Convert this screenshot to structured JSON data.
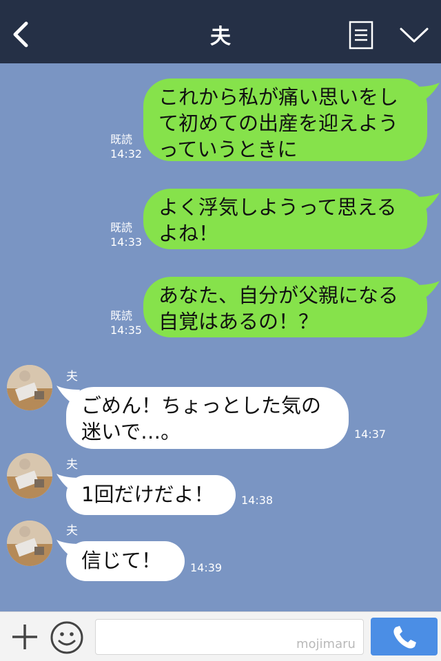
{
  "header": {
    "title": "夫",
    "icons": {
      "back": "back-chevron-icon",
      "menu": "menu-list-icon",
      "expand": "chevron-down-icon"
    }
  },
  "messages": [
    {
      "from": "me",
      "lines": [
        "これから私が痛い思いをし",
        "て初めての出産を迎えよう",
        "っていうときに"
      ],
      "read": "既読",
      "time": "14:32"
    },
    {
      "from": "me",
      "lines": [
        "よく浮気しようって思える",
        "よね！"
      ],
      "read": "既読",
      "time": "14:33"
    },
    {
      "from": "me",
      "lines": [
        "あなた、自分が父親になる",
        "自覚はあるの！？"
      ],
      "read": "既読",
      "time": "14:35"
    },
    {
      "from": "other",
      "sender": "夫",
      "lines": [
        "ごめん！ちょっとした気の",
        "迷いで…。"
      ],
      "time": "14:37"
    },
    {
      "from": "other",
      "sender": "夫",
      "lines": [
        "1回だけだよ！"
      ],
      "time": "14:38"
    },
    {
      "from": "other",
      "sender": "夫",
      "lines": [
        "信じて！"
      ],
      "time": "14:39"
    }
  ],
  "footer": {
    "input_value": "",
    "watermark": "mojimaru",
    "icons": {
      "plus": "plus-icon",
      "emoji": "smiley-icon",
      "call": "phone-icon"
    }
  },
  "colors": {
    "header_bg": "#253046",
    "chat_bg": "#7a95c3",
    "my_bubble": "#86e24b",
    "other_bubble": "#ffffff",
    "call_button": "#4b8ee5"
  }
}
